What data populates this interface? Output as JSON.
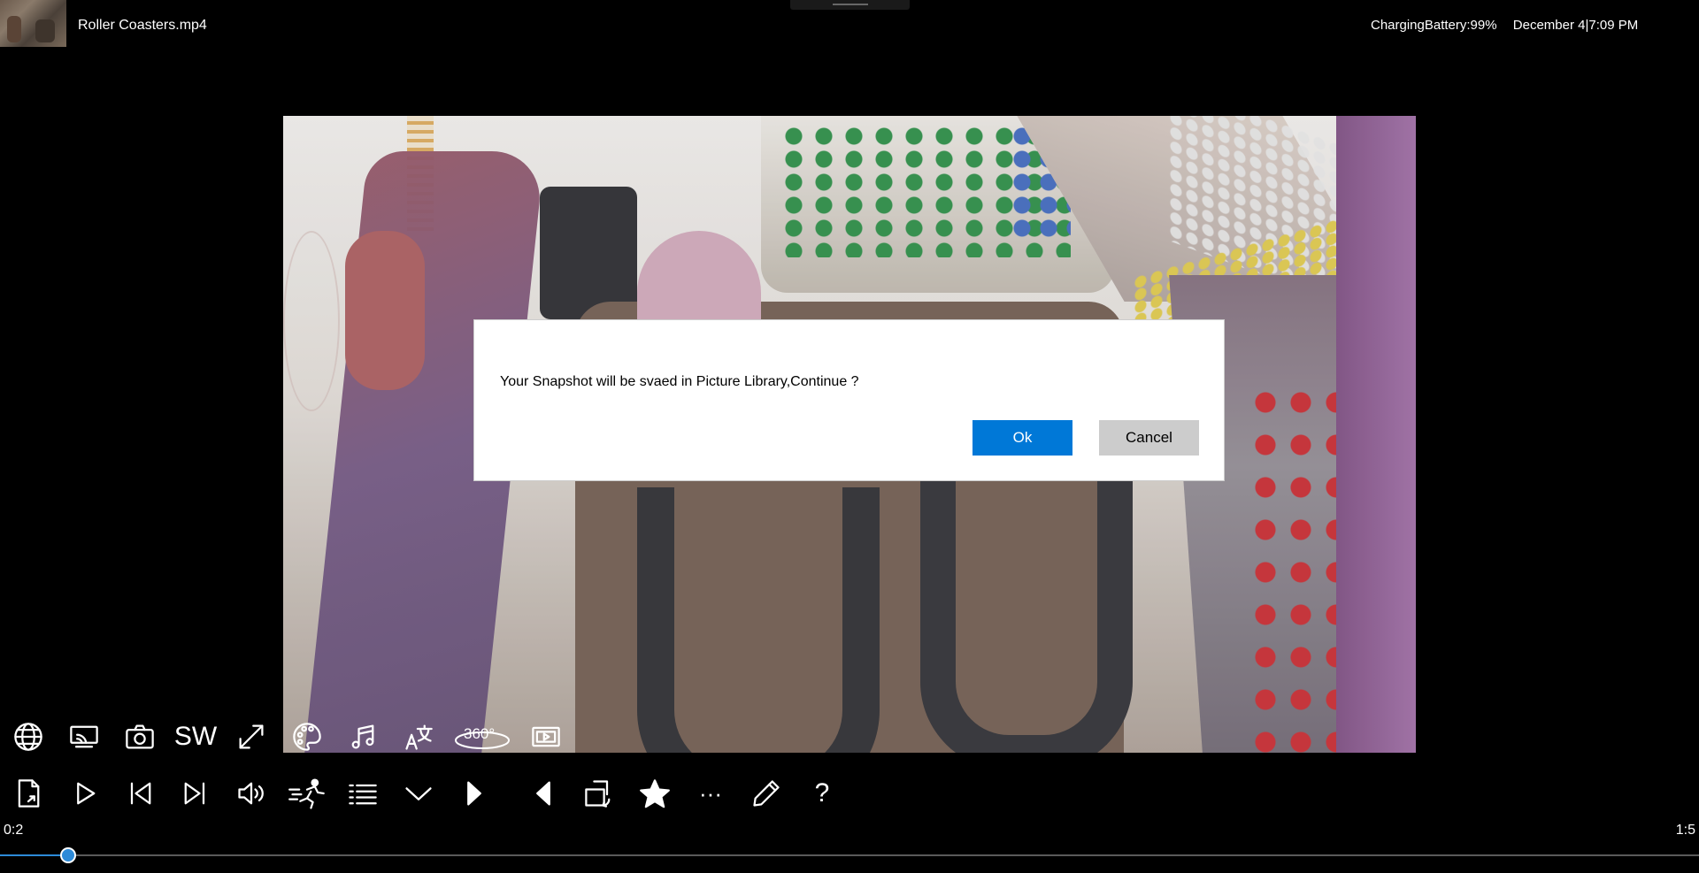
{
  "window": {
    "file_title": "Roller Coasters.mp4",
    "battery_status": "ChargingBattery:99%",
    "date_time": "December 4|7:09 PM"
  },
  "dialog": {
    "message": "Your Snapshot will be svaed in Picture Library,Continue ?",
    "ok_label": "Ok",
    "cancel_label": "Cancel"
  },
  "toolbar_top": {
    "sw_label": "SW",
    "three_sixty_label": "360°",
    "icons": [
      "globe-icon",
      "cast-icon",
      "camera-icon",
      "sw-text",
      "fullscreen-icon",
      "palette-icon",
      "music-icon",
      "subtitle-icon",
      "360-icon",
      "video-frame-icon"
    ]
  },
  "toolbar_bottom": {
    "icons": [
      "open-file-icon",
      "play-icon",
      "previous-icon",
      "next-icon",
      "volume-icon",
      "speed-icon",
      "playlist-icon",
      "chevron-down-icon",
      "step-forward-icon",
      "step-back-icon",
      "rotate-icon",
      "star-icon",
      "more-icon",
      "edit-icon",
      "help-icon"
    ],
    "more_glyph": "···",
    "help_glyph": "?"
  },
  "playback": {
    "current_time": "0:2",
    "total_time": "1:5",
    "progress": 0.04
  },
  "colors": {
    "accent": "#0078d7",
    "seek": "#2d8ad8",
    "background": "#000000"
  }
}
